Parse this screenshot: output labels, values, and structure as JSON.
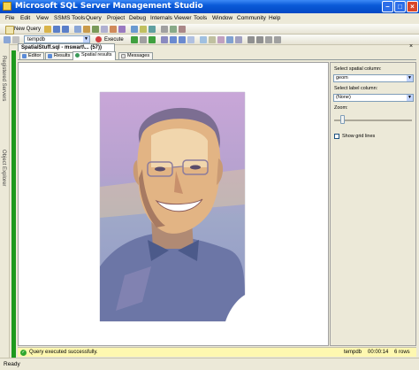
{
  "window": {
    "title": "Microsoft SQL Server Management Studio"
  },
  "menu": [
    "File",
    "Edit",
    "View",
    "SSMS Tools",
    "Query",
    "Project",
    "Debug",
    "Internals Viewer",
    "Tools",
    "Window",
    "Community",
    "Help"
  ],
  "toolbar": {
    "new_query": "New Query",
    "database": "tempdb",
    "execute": "Execute"
  },
  "side": {
    "registered_servers": "Registered Servers",
    "object_explorer": "Object Explorer"
  },
  "document_tab": "SpatialStuff.sql - mswart\\... (57))",
  "result_tabs": [
    "Editor",
    "Results",
    "Spatial results",
    "Messages"
  ],
  "active_result_tab": "Spatial results",
  "panel": {
    "spatial_column_label": "Select spatial column:",
    "spatial_column_value": "geom",
    "label_column_label": "Select label column:",
    "label_column_value": "(None)",
    "zoom_label": "Zoom:",
    "zoom_level": 0.08,
    "show_grid_label": "Show grid lines",
    "show_grid_checked": false
  },
  "query_status": {
    "message": "Query executed successfully.",
    "database": "tempdb",
    "elapsed": "00:00:14",
    "rows": "6 rows"
  },
  "app_status": "Ready",
  "colors": {
    "title_bar": "#0a5ad8",
    "editor_margin": "#1e9a1e",
    "status_bar": "#fef8b0"
  }
}
